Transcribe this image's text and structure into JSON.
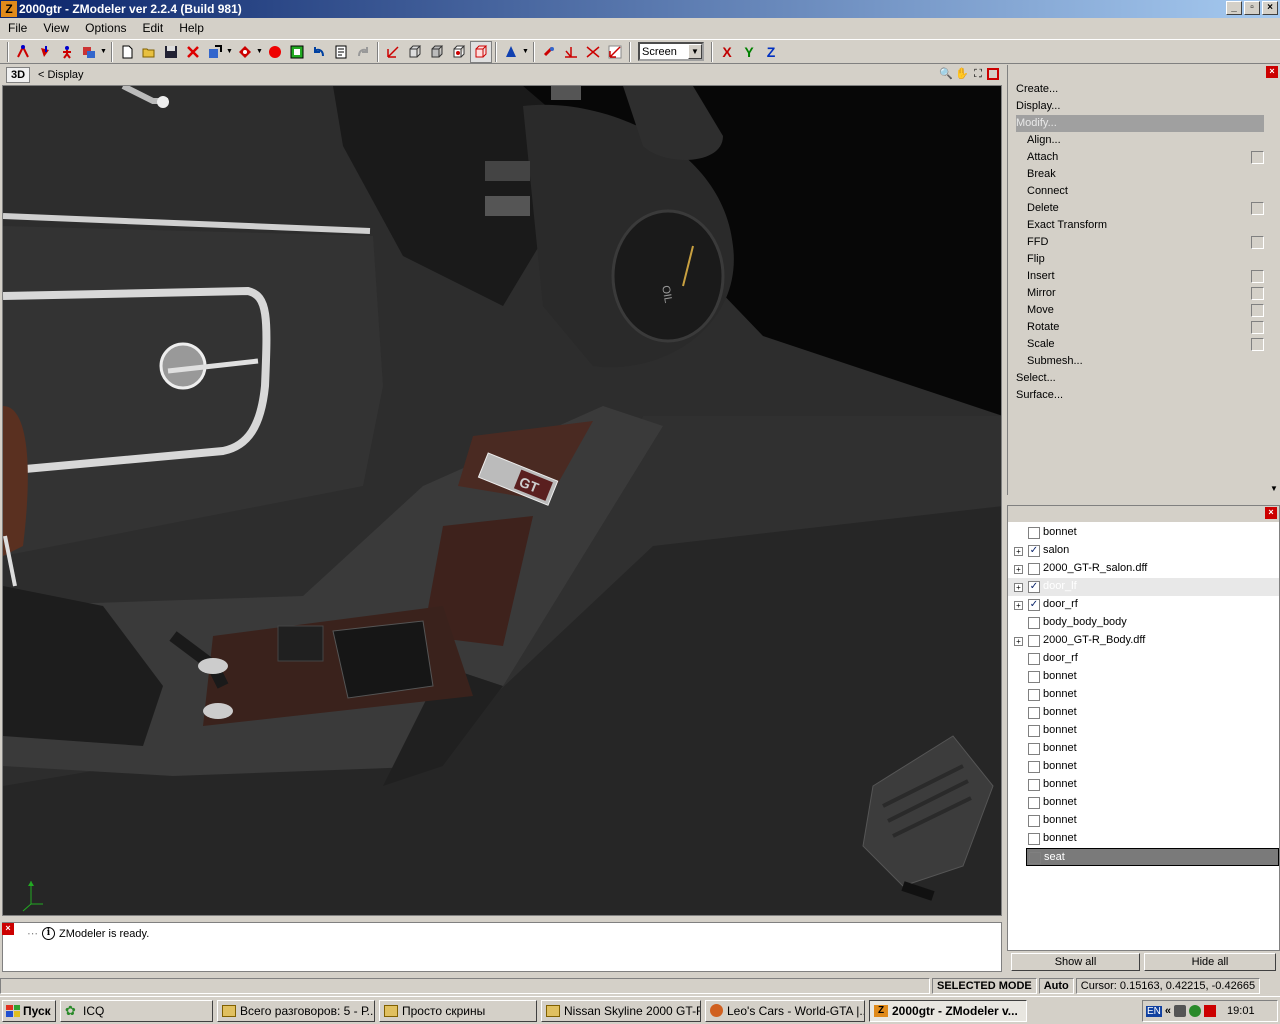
{
  "window": {
    "title": "2000gtr - ZModeler ver 2.2.4 (Build 981)",
    "app_icon_letter": "Z",
    "min_glyph": "_",
    "max_glyph": "▫",
    "close_glyph": "×"
  },
  "menu": {
    "items": [
      {
        "label": "File"
      },
      {
        "label": "View"
      },
      {
        "label": "Options"
      },
      {
        "label": "Edit"
      },
      {
        "label": "Help"
      }
    ]
  },
  "toolbar": {
    "view_mode": "Screen",
    "axes": [
      {
        "label": "X",
        "color": "#c00000"
      },
      {
        "label": "Y",
        "color": "#008000"
      },
      {
        "label": "Z",
        "color": "#0030c0"
      }
    ]
  },
  "viewport": {
    "tag": "3D",
    "display_label": "<  Display",
    "gauge_text": "OIL"
  },
  "command_panel": {
    "items": [
      {
        "label": "Create...",
        "level": 0
      },
      {
        "label": "Display...",
        "level": 0
      },
      {
        "label": "Modify...",
        "level": 0,
        "selected": true
      },
      {
        "label": "Align...",
        "level": 1
      },
      {
        "label": "Attach",
        "level": 1,
        "check": true
      },
      {
        "label": "Break",
        "level": 1
      },
      {
        "label": "Connect",
        "level": 1
      },
      {
        "label": "Delete",
        "level": 1,
        "check": true
      },
      {
        "label": "Exact Transform",
        "level": 1
      },
      {
        "label": "FFD",
        "level": 1,
        "check": true
      },
      {
        "label": "Flip",
        "level": 1
      },
      {
        "label": "Insert",
        "level": 1,
        "check": true
      },
      {
        "label": "Mirror",
        "level": 1,
        "check": true
      },
      {
        "label": "Move",
        "level": 1,
        "check": true
      },
      {
        "label": "Rotate",
        "level": 1,
        "check": true
      },
      {
        "label": "Scale",
        "level": 1,
        "check": true
      },
      {
        "label": "Submesh...",
        "level": 1
      },
      {
        "label": "Select...",
        "level": 0
      },
      {
        "label": "Surface...",
        "level": 0
      }
    ]
  },
  "tree": {
    "rows": [
      {
        "label": "bonnet",
        "checked": false,
        "expander": false
      },
      {
        "label": "salon",
        "checked": true,
        "expander": true
      },
      {
        "label": "2000_GT-R_salon.dff",
        "checked": false,
        "expander": true
      },
      {
        "label": "door_lf",
        "checked": true,
        "expander": true,
        "highlight": true
      },
      {
        "label": "door_rf",
        "checked": true,
        "expander": true
      },
      {
        "label": "body_body_body",
        "checked": false,
        "expander": false
      },
      {
        "label": "2000_GT-R_Body.dff",
        "checked": false,
        "expander": true
      },
      {
        "label": "door_rf",
        "checked": false,
        "expander": false
      },
      {
        "label": "bonnet",
        "checked": false,
        "expander": false
      },
      {
        "label": "bonnet",
        "checked": false,
        "expander": false
      },
      {
        "label": "bonnet",
        "checked": false,
        "expander": false
      },
      {
        "label": "bonnet",
        "checked": false,
        "expander": false
      },
      {
        "label": "bonnet",
        "checked": false,
        "expander": false
      },
      {
        "label": "bonnet",
        "checked": false,
        "expander": false
      },
      {
        "label": "bonnet",
        "checked": false,
        "expander": false
      },
      {
        "label": "bonnet",
        "checked": false,
        "expander": false
      },
      {
        "label": "bonnet",
        "checked": false,
        "expander": false
      },
      {
        "label": "bonnet",
        "checked": false,
        "expander": false
      },
      {
        "label": "seat",
        "checked": false,
        "expander": false,
        "selected": true
      }
    ],
    "show_all": "Show all",
    "hide_all": "Hide all"
  },
  "log": {
    "message": "ZModeler is ready.",
    "info_glyph": "i"
  },
  "status": {
    "mode": "SELECTED MODE",
    "auto": "Auto",
    "cursor": "Cursor: 0.15163, 0.42215, -0.42665"
  },
  "taskbar": {
    "start": "Пуск",
    "tasks": [
      {
        "label": "ICQ",
        "icon_color": "#2a8a2a"
      },
      {
        "label": "Всего разговоров: 5 - Р...",
        "icon_color": "#e0c060"
      },
      {
        "label": "Просто скрины",
        "icon_color": "#e0c060"
      },
      {
        "label": "Nissan Skyline 2000 GT-R",
        "icon_color": "#e0c060"
      },
      {
        "label": "Leo's Cars - World-GTA |...",
        "icon_color": "#d06020"
      },
      {
        "label": "2000gtr - ZModeler v...",
        "icon_color": "#e08a1a",
        "active": true
      }
    ],
    "lang": "EN",
    "chevron": "«",
    "clock": "19:01"
  }
}
